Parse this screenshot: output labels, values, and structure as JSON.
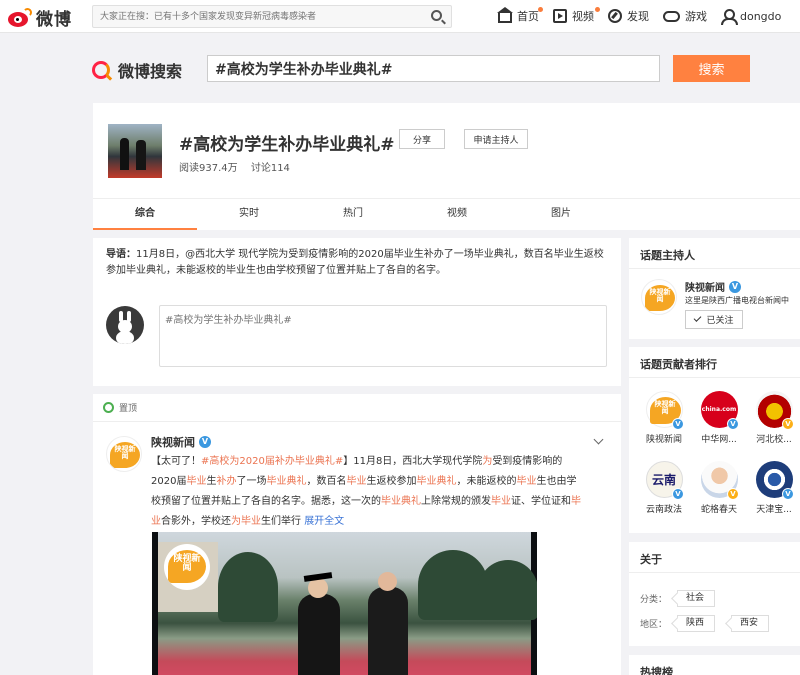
{
  "topnav": {
    "logo_text": "微博",
    "search_placeholder": "大家正在搜：已有十多个国家发现变异新冠病毒感染者",
    "items": [
      {
        "label": "首页",
        "icon": "home-icon",
        "badge": true
      },
      {
        "label": "视频",
        "icon": "video-icon",
        "badge": true
      },
      {
        "label": "发现",
        "icon": "discover-icon",
        "badge": false
      },
      {
        "label": "游戏",
        "icon": "game-icon",
        "badge": false
      },
      {
        "label": "dongdo",
        "icon": "user-icon",
        "badge": false
      }
    ]
  },
  "search": {
    "logo_text": "微博搜索",
    "query": "#高校为学生补办毕业典礼#",
    "button": "搜索"
  },
  "topic": {
    "title": "#高校为学生补办毕业典礼#",
    "share": "分享",
    "apply_host": "申请主持人",
    "reads": "阅读937.4万",
    "discussions": "讨论114",
    "tabs": [
      "综合",
      "实时",
      "热门",
      "视频",
      "图片"
    ],
    "active_tab": 0
  },
  "intro": {
    "label": "导语：",
    "text": "11月8日，@西北大学 现代学院为受到疫情影响的2020届毕业生补办了一场毕业典礼，数百名毕业生返校参加毕业典礼，未能返校的毕业生也由学校预留了位置并贴上了各自的名字。",
    "comment_placeholder": "#高校为学生补办毕业典礼#"
  },
  "post": {
    "pin_label": "置顶",
    "author": "陕视新闻",
    "segments": [
      {
        "t": "【太可了！",
        "c": ""
      },
      {
        "t": "#高校为2020届补办毕业典礼#",
        "c": "tag"
      },
      {
        "t": "】11月8日，西北大学现代学院",
        "c": ""
      },
      {
        "t": "为",
        "c": "hl"
      },
      {
        "t": "受到疫情影响的2020届",
        "c": ""
      },
      {
        "t": "毕业",
        "c": "hl"
      },
      {
        "t": "生",
        "c": ""
      },
      {
        "t": "补办",
        "c": "hl"
      },
      {
        "t": "了一场",
        "c": ""
      },
      {
        "t": "毕业典礼",
        "c": "hl"
      },
      {
        "t": "，数百名",
        "c": ""
      },
      {
        "t": "毕业",
        "c": "hl"
      },
      {
        "t": "生返校参加",
        "c": ""
      },
      {
        "t": "毕业典礼",
        "c": "hl"
      },
      {
        "t": "，未能返校的",
        "c": ""
      },
      {
        "t": "毕业",
        "c": "hl"
      },
      {
        "t": "生也由学校预留了位置并贴上了各自的名字。据悉，这一次的",
        "c": ""
      },
      {
        "t": "毕业典礼",
        "c": "hl"
      },
      {
        "t": "上除常规的颁发",
        "c": ""
      },
      {
        "t": "毕业",
        "c": "hl"
      },
      {
        "t": "证、学位证和",
        "c": ""
      },
      {
        "t": "毕业",
        "c": "hl"
      },
      {
        "t": "合影外，学校还",
        "c": ""
      },
      {
        "t": "为",
        "c": "hl"
      },
      {
        "t": "毕业",
        "c": "hl"
      },
      {
        "t": "生们举行 ",
        "c": ""
      },
      {
        "t": "展开全文",
        "c": "more"
      }
    ],
    "video_logo_text": "陕视新闻"
  },
  "sidebar": {
    "host_section": {
      "title": "话题主持人",
      "name": "陕视新闻",
      "desc": "这里是陕西广播电视台新闻中",
      "followed": "已关注",
      "avatar_text": "陕视新闻"
    },
    "contrib_section": {
      "title": "话题贡献者排行",
      "items": [
        {
          "name": "陕视新闻",
          "kind": "sx",
          "badge": "blue"
        },
        {
          "name": "中华网...",
          "kind": "china",
          "badge": "blue",
          "logo_text": "china.com"
        },
        {
          "name": "河北校...",
          "kind": "hebei",
          "badge": "yellow"
        },
        {
          "name": "云南政法",
          "kind": "yunnan",
          "badge": "blue",
          "logo_text": "云南"
        },
        {
          "name": "蛇格春天",
          "kind": "person",
          "badge": "yellow"
        },
        {
          "name": "天津宝...",
          "kind": "tianjin",
          "badge": "blue"
        }
      ]
    },
    "about_section": {
      "title": "关于",
      "category_label": "分类：",
      "category": "社会",
      "region_label": "地区：",
      "regions": [
        "陕西",
        "西安"
      ]
    },
    "hot_section": {
      "title": "热搜榜"
    }
  },
  "colors": {
    "accent": "#ff8140",
    "highlight": "#eb7350",
    "link_blue": "#3b74d6",
    "weibo_red": "#e6162d"
  }
}
